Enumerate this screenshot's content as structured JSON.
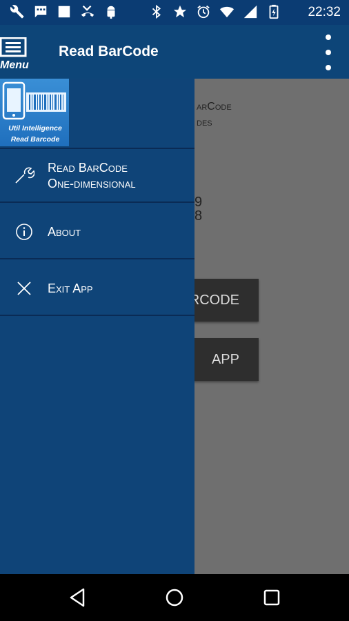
{
  "status_bar": {
    "time": "22:32",
    "left_icons": [
      "wrench-icon",
      "message-icon",
      "square-icon",
      "missed-call-icon",
      "android-icon"
    ],
    "right_icons": [
      "bluetooth-icon",
      "star-icon",
      "alarm-icon",
      "wifi-icon",
      "signal-icon",
      "battery-icon"
    ]
  },
  "app_bar": {
    "menu_label": "Menu",
    "title": "Read BarCode"
  },
  "drawer": {
    "logo": {
      "line1": "Util Intelligence",
      "line2": "Read Barcode"
    },
    "items": [
      {
        "icon": "wrench-icon",
        "line1": "Read BarCode",
        "line2": "One-dimensional"
      },
      {
        "icon": "info-icon",
        "line1": "About",
        "line2": ""
      },
      {
        "icon": "close-icon",
        "line1": "Exit App",
        "line2": ""
      }
    ]
  },
  "background_content": {
    "text1": "arCode",
    "text2": "des",
    "num1": "9",
    "num2": "8",
    "button1": "ARCODE",
    "button2": "APP"
  },
  "colors": {
    "primary": "#0d4578",
    "drawer": "#0f4478",
    "status_bar": "#0b3c73",
    "scrim": "#6f6f6f"
  }
}
